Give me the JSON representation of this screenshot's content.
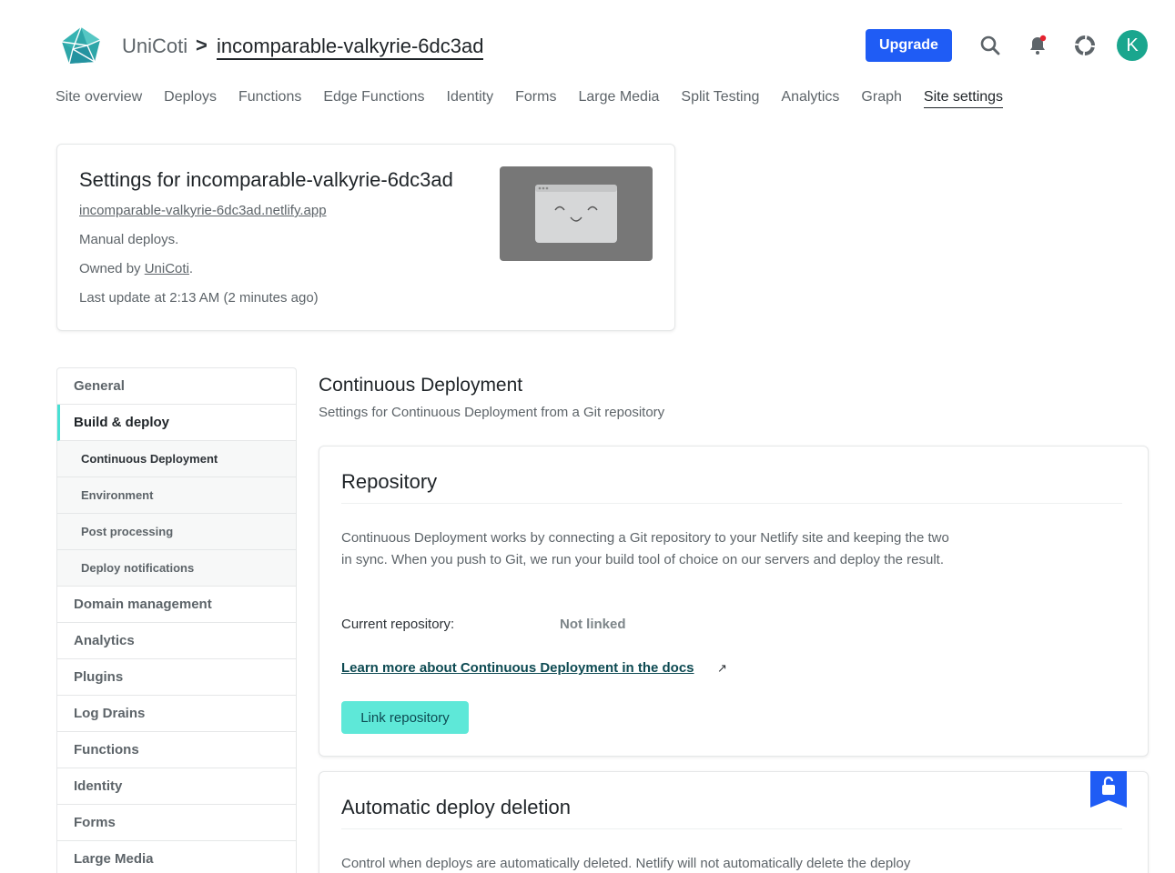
{
  "header": {
    "team": "UniCoti",
    "separator": ">",
    "site": "incomparable-valkyrie-6dc3ad",
    "upgrade_label": "Upgrade",
    "avatar_initial": "K",
    "icons": [
      "search-icon",
      "bell-icon",
      "help-ring-icon"
    ],
    "colors": {
      "brand": "#1f5cf5",
      "avatar": "#1aa68e",
      "notification_dot": "#e5222f"
    }
  },
  "nav": {
    "tabs": [
      "Site overview",
      "Deploys",
      "Functions",
      "Edge Functions",
      "Identity",
      "Forms",
      "Large Media",
      "Split Testing",
      "Analytics",
      "Graph",
      "Site settings"
    ],
    "active": "Site settings"
  },
  "site_card": {
    "title": "Settings for incomparable-valkyrie-6dc3ad",
    "url": "incomparable-valkyrie-6dc3ad.netlify.app",
    "deploy_mode": "Manual deploys.",
    "owned_prefix": "Owned by ",
    "owner": "UniCoti",
    "owned_suffix": ".",
    "last_update": "Last update at 2:13 AM (2 minutes ago)"
  },
  "sidebar": {
    "general": "General",
    "build_deploy": "Build & deploy",
    "sub_items": [
      "Continuous Deployment",
      "Environment",
      "Post processing",
      "Deploy notifications"
    ],
    "items": [
      "Domain management",
      "Analytics",
      "Plugins",
      "Log Drains",
      "Functions",
      "Identity",
      "Forms",
      "Large Media"
    ],
    "accent": "#48e0d4"
  },
  "main": {
    "title": "Continuous Deployment",
    "subtitle": "Settings for Continuous Deployment from a Git repository",
    "repository": {
      "title": "Repository",
      "description": "Continuous Deployment works by connecting a Git repository to your Netlify site and keeping the two in sync. When you push to Git, we run your build tool of choice on our servers and deploy the result.",
      "current_label": "Current repository:",
      "current_value": "Not linked",
      "docs_link": "Learn more about Continuous Deployment in the docs",
      "docs_arrow": "↗",
      "link_button": "Link repository",
      "button_color": "#5ee8d8"
    },
    "auto_delete": {
      "title": "Automatic deploy deletion",
      "description": "Control when deploys are automatically deleted. Netlify will not automatically delete the deploy"
    }
  }
}
